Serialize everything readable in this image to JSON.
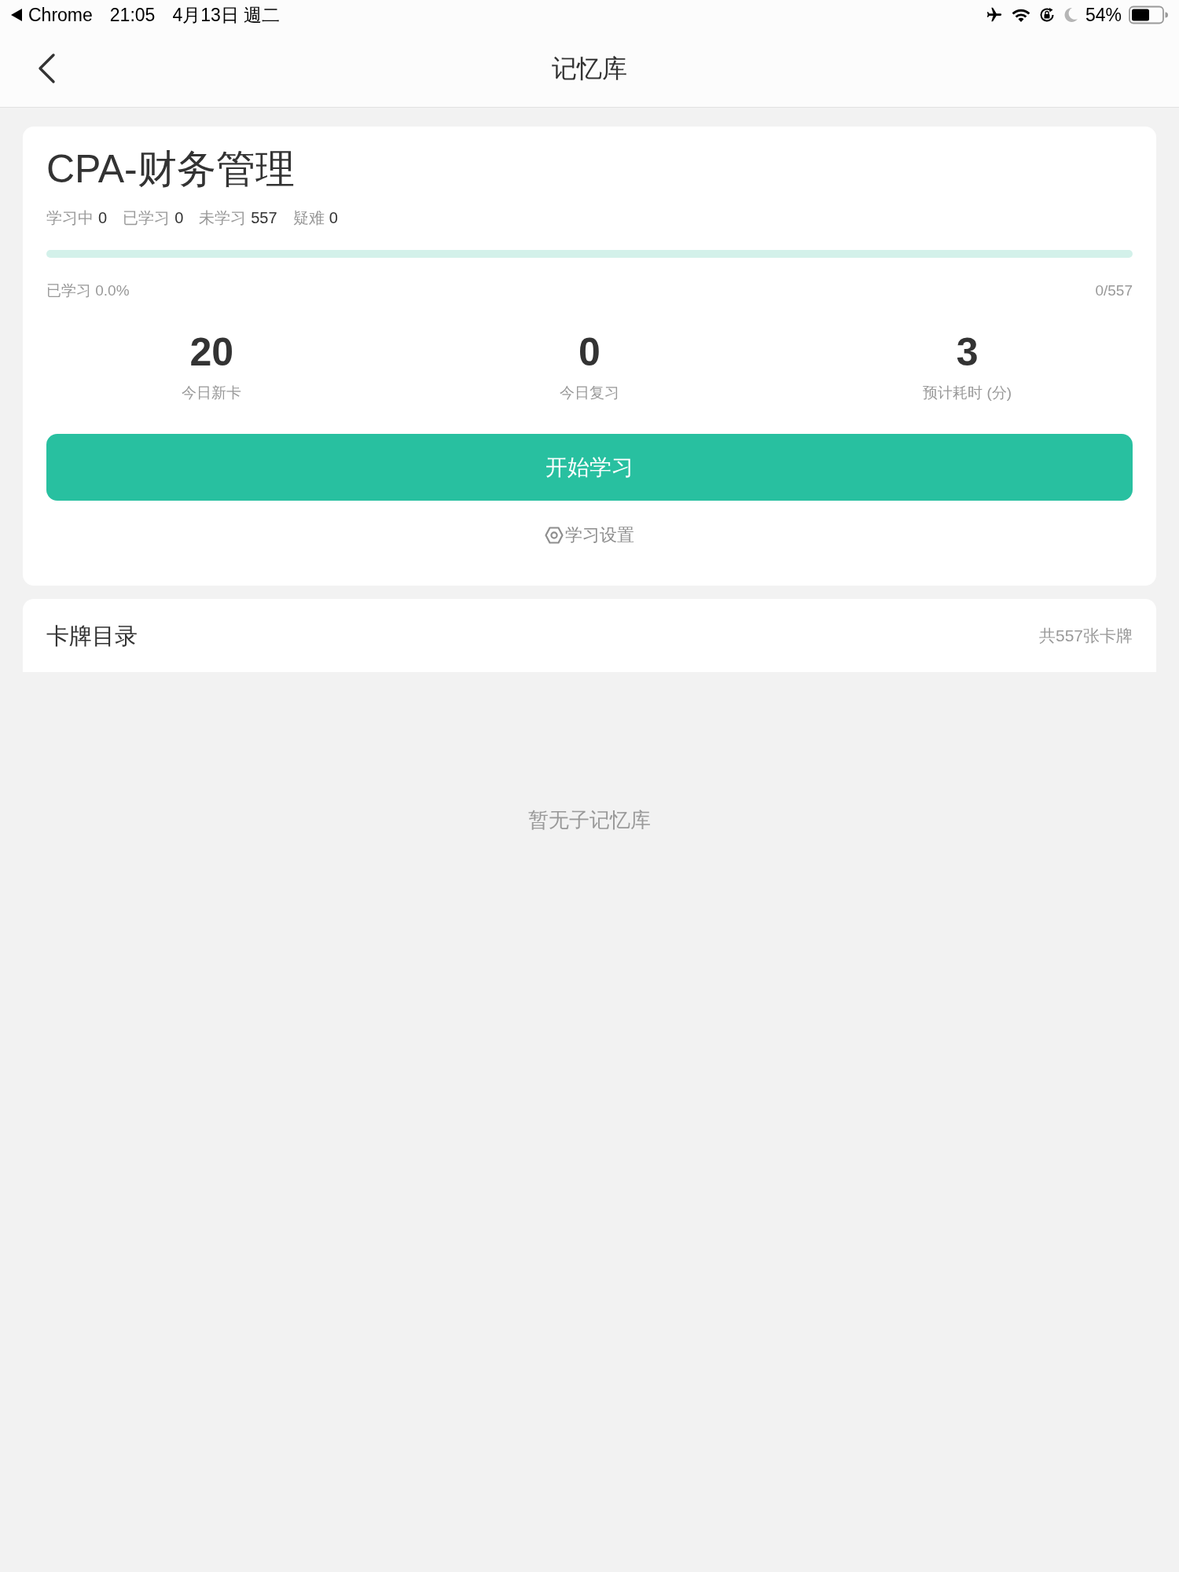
{
  "status_bar": {
    "back_app": "Chrome",
    "time": "21:05",
    "date": "4月13日 週二",
    "battery": "54%"
  },
  "header": {
    "title": "记忆库"
  },
  "deck": {
    "title": "CPA-财务管理",
    "counts": [
      {
        "label": "学习中",
        "value": "0"
      },
      {
        "label": "已学习",
        "value": "0"
      },
      {
        "label": "未学习",
        "value": "557"
      },
      {
        "label": "疑难",
        "value": "0"
      }
    ],
    "progress": {
      "level": 0
    },
    "progress_label": "已学习 0.0%",
    "progress_count": "0/557",
    "stats": [
      {
        "value": "20",
        "label": "今日新卡"
      },
      {
        "value": "0",
        "label": "今日复习"
      },
      {
        "value": "3",
        "label": "预计耗时 (分)"
      }
    ],
    "start_button": "开始学习",
    "settings_link": "学习设置"
  },
  "catalog": {
    "title": "卡牌目录",
    "count": "共557张卡牌"
  },
  "empty_message": "暂无子记忆库"
}
